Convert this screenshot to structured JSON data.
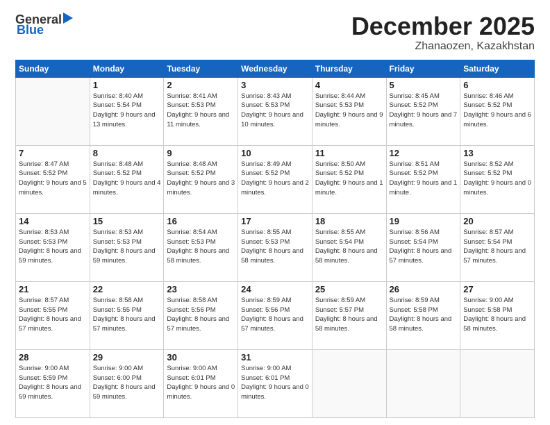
{
  "header": {
    "logo_general": "General",
    "logo_blue": "Blue",
    "month_title": "December 2025",
    "location": "Zhanaozen, Kazakhstan"
  },
  "calendar": {
    "days_of_week": [
      "Sunday",
      "Monday",
      "Tuesday",
      "Wednesday",
      "Thursday",
      "Friday",
      "Saturday"
    ],
    "weeks": [
      [
        {
          "day": "",
          "empty": true
        },
        {
          "day": "1",
          "sunrise": "8:40 AM",
          "sunset": "5:54 PM",
          "daylight": "9 hours and 13 minutes."
        },
        {
          "day": "2",
          "sunrise": "8:41 AM",
          "sunset": "5:53 PM",
          "daylight": "9 hours and 11 minutes."
        },
        {
          "day": "3",
          "sunrise": "8:43 AM",
          "sunset": "5:53 PM",
          "daylight": "9 hours and 10 minutes."
        },
        {
          "day": "4",
          "sunrise": "8:44 AM",
          "sunset": "5:53 PM",
          "daylight": "9 hours and 9 minutes."
        },
        {
          "day": "5",
          "sunrise": "8:45 AM",
          "sunset": "5:52 PM",
          "daylight": "9 hours and 7 minutes."
        },
        {
          "day": "6",
          "sunrise": "8:46 AM",
          "sunset": "5:52 PM",
          "daylight": "9 hours and 6 minutes."
        }
      ],
      [
        {
          "day": "7",
          "sunrise": "8:47 AM",
          "sunset": "5:52 PM",
          "daylight": "9 hours and 5 minutes."
        },
        {
          "day": "8",
          "sunrise": "8:48 AM",
          "sunset": "5:52 PM",
          "daylight": "9 hours and 4 minutes."
        },
        {
          "day": "9",
          "sunrise": "8:48 AM",
          "sunset": "5:52 PM",
          "daylight": "9 hours and 3 minutes."
        },
        {
          "day": "10",
          "sunrise": "8:49 AM",
          "sunset": "5:52 PM",
          "daylight": "9 hours and 2 minutes."
        },
        {
          "day": "11",
          "sunrise": "8:50 AM",
          "sunset": "5:52 PM",
          "daylight": "9 hours and 1 minute."
        },
        {
          "day": "12",
          "sunrise": "8:51 AM",
          "sunset": "5:52 PM",
          "daylight": "9 hours and 1 minute."
        },
        {
          "day": "13",
          "sunrise": "8:52 AM",
          "sunset": "5:52 PM",
          "daylight": "9 hours and 0 minutes."
        }
      ],
      [
        {
          "day": "14",
          "sunrise": "8:53 AM",
          "sunset": "5:53 PM",
          "daylight": "8 hours and 59 minutes."
        },
        {
          "day": "15",
          "sunrise": "8:53 AM",
          "sunset": "5:53 PM",
          "daylight": "8 hours and 59 minutes."
        },
        {
          "day": "16",
          "sunrise": "8:54 AM",
          "sunset": "5:53 PM",
          "daylight": "8 hours and 58 minutes."
        },
        {
          "day": "17",
          "sunrise": "8:55 AM",
          "sunset": "5:53 PM",
          "daylight": "8 hours and 58 minutes."
        },
        {
          "day": "18",
          "sunrise": "8:55 AM",
          "sunset": "5:54 PM",
          "daylight": "8 hours and 58 minutes."
        },
        {
          "day": "19",
          "sunrise": "8:56 AM",
          "sunset": "5:54 PM",
          "daylight": "8 hours and 57 minutes."
        },
        {
          "day": "20",
          "sunrise": "8:57 AM",
          "sunset": "5:54 PM",
          "daylight": "8 hours and 57 minutes."
        }
      ],
      [
        {
          "day": "21",
          "sunrise": "8:57 AM",
          "sunset": "5:55 PM",
          "daylight": "8 hours and 57 minutes."
        },
        {
          "day": "22",
          "sunrise": "8:58 AM",
          "sunset": "5:55 PM",
          "daylight": "8 hours and 57 minutes."
        },
        {
          "day": "23",
          "sunrise": "8:58 AM",
          "sunset": "5:56 PM",
          "daylight": "8 hours and 57 minutes."
        },
        {
          "day": "24",
          "sunrise": "8:59 AM",
          "sunset": "5:56 PM",
          "daylight": "8 hours and 57 minutes."
        },
        {
          "day": "25",
          "sunrise": "8:59 AM",
          "sunset": "5:57 PM",
          "daylight": "8 hours and 58 minutes."
        },
        {
          "day": "26",
          "sunrise": "8:59 AM",
          "sunset": "5:58 PM",
          "daylight": "8 hours and 58 minutes."
        },
        {
          "day": "27",
          "sunrise": "9:00 AM",
          "sunset": "5:58 PM",
          "daylight": "8 hours and 58 minutes."
        }
      ],
      [
        {
          "day": "28",
          "sunrise": "9:00 AM",
          "sunset": "5:59 PM",
          "daylight": "8 hours and 59 minutes."
        },
        {
          "day": "29",
          "sunrise": "9:00 AM",
          "sunset": "6:00 PM",
          "daylight": "8 hours and 59 minutes."
        },
        {
          "day": "30",
          "sunrise": "9:00 AM",
          "sunset": "6:01 PM",
          "daylight": "9 hours and 0 minutes."
        },
        {
          "day": "31",
          "sunrise": "9:00 AM",
          "sunset": "6:01 PM",
          "daylight": "9 hours and 0 minutes."
        },
        {
          "day": "",
          "empty": true
        },
        {
          "day": "",
          "empty": true
        },
        {
          "day": "",
          "empty": true
        }
      ]
    ]
  }
}
